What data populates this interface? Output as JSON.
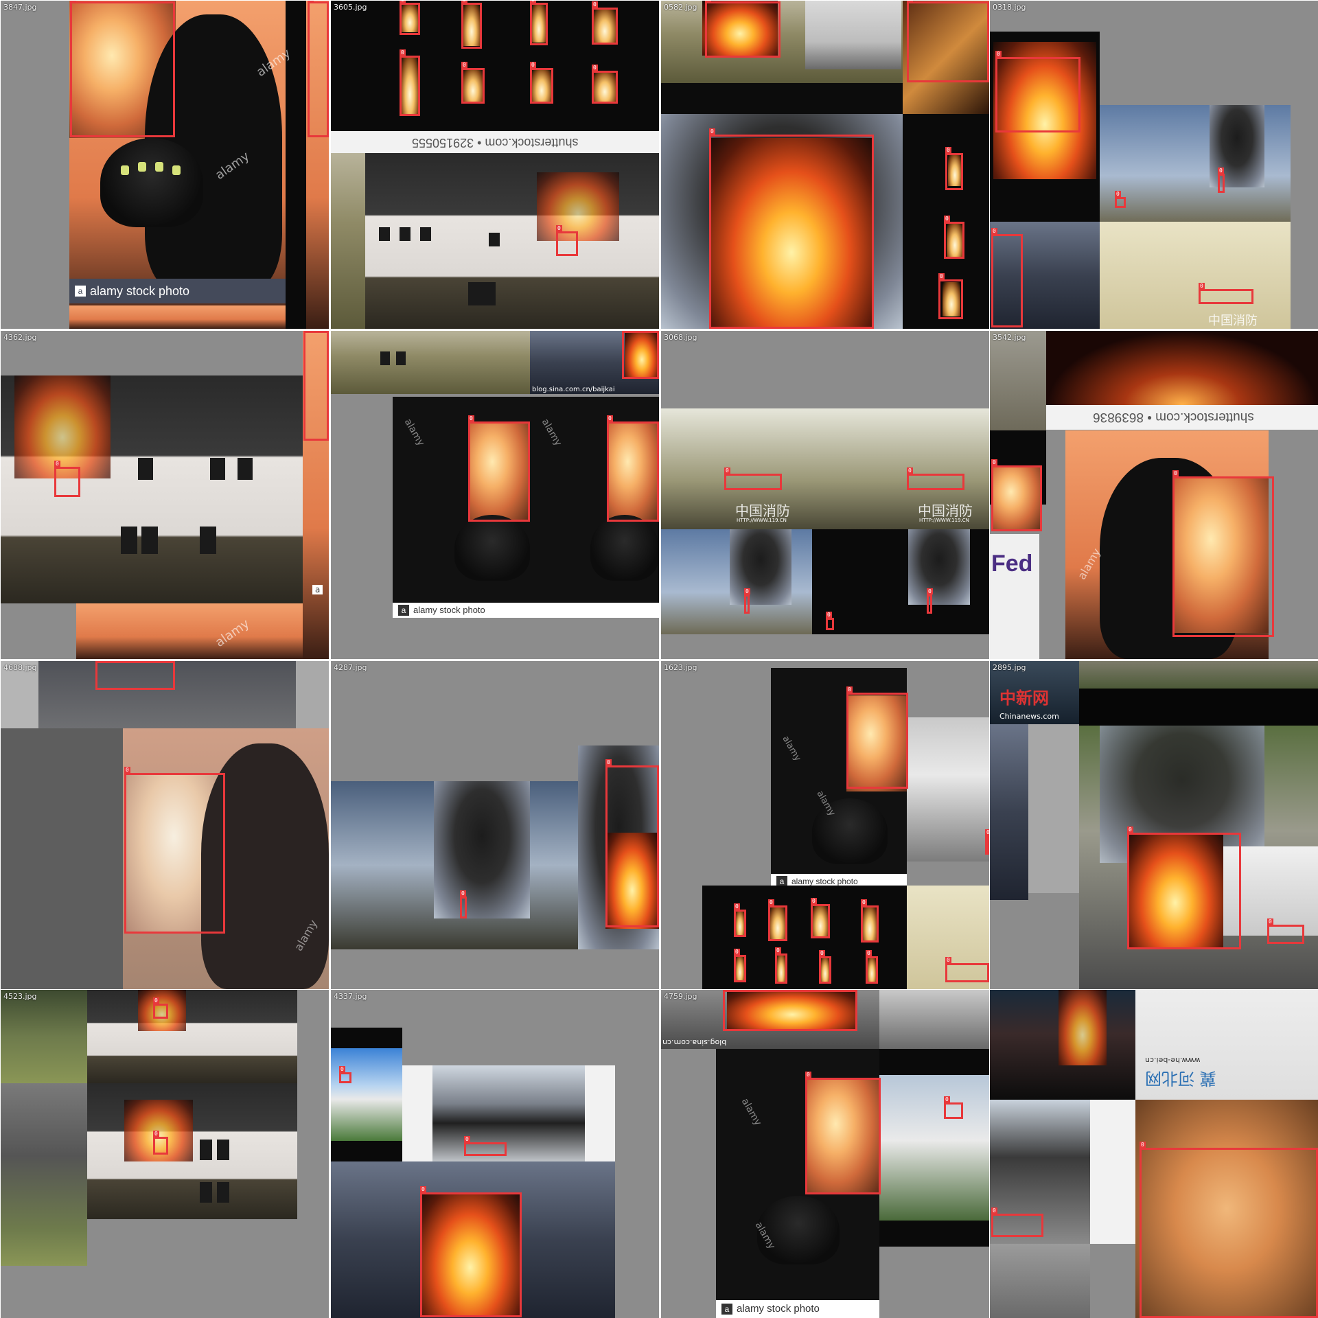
{
  "tiles": [
    {
      "filename": "3847.jpg",
      "watermarks": {
        "alamy": "alamy stock photo",
        "alamy_a": "a",
        "alamy_diag1": "alamy",
        "alamy_diag2": "alamy"
      }
    },
    {
      "filename": "3605.jpg",
      "watermarks": {
        "shutterstock": "shutterstock.com • 329150555"
      }
    },
    {
      "filename": "0582.jpg",
      "watermarks": {}
    },
    {
      "filename": "0318.jpg",
      "watermarks": {
        "cn": "中国消防"
      }
    },
    {
      "filename": "4362.jpg",
      "watermarks": {
        "alamy_a": "a",
        "alamy_diag": "alamy"
      }
    },
    {
      "filename": "",
      "watermarks": {
        "sina": "blog.sina.com.cn/baijkai",
        "alamy": "alamy stock photo",
        "alamy_a": "a",
        "alamy_diag1": "alamy",
        "alamy_diag2": "alamy"
      }
    },
    {
      "filename": "3068.jpg",
      "watermarks": {
        "cn1": "中国消防",
        "cn1_url": "HTTP://WWW.119.CN",
        "cn2": "中国消防",
        "cn2_url": "HTTP://WWW.119.CN"
      }
    },
    {
      "filename": "3542.jpg",
      "watermarks": {
        "shutterstock": "shutterstock.com • 8639836",
        "fedex": "Fed",
        "alamy_diag": "alamy"
      }
    },
    {
      "filename": "4688.jpg",
      "watermarks": {
        "alamy_diag": "alamy"
      }
    },
    {
      "filename": "4287.jpg",
      "watermarks": {}
    },
    {
      "filename": "1623.jpg",
      "watermarks": {
        "alamy": "alamy stock photo",
        "alamy_a": "a",
        "alamy_diag1": "alamy",
        "alamy_diag2": "alamy"
      }
    },
    {
      "filename": "2895.jpg",
      "watermarks": {
        "chinanews_cn": "中新网",
        "chinanews": "Chinanews.com"
      }
    },
    {
      "filename": "4523.jpg",
      "watermarks": {}
    },
    {
      "filename": "4337.jpg",
      "watermarks": {}
    },
    {
      "filename": "4759.jpg",
      "watermarks": {
        "sina": "blog.sina.com.cn",
        "alamy": "alamy stock photo",
        "alamy_a": "a",
        "alamy_diag1": "alamy",
        "alamy_diag2": "alamy"
      }
    },
    {
      "filename": "",
      "watermarks": {
        "hebei_cn": "冀 河北网",
        "hebei_url": "www.he-bei.cn"
      }
    }
  ],
  "box_label": "0"
}
